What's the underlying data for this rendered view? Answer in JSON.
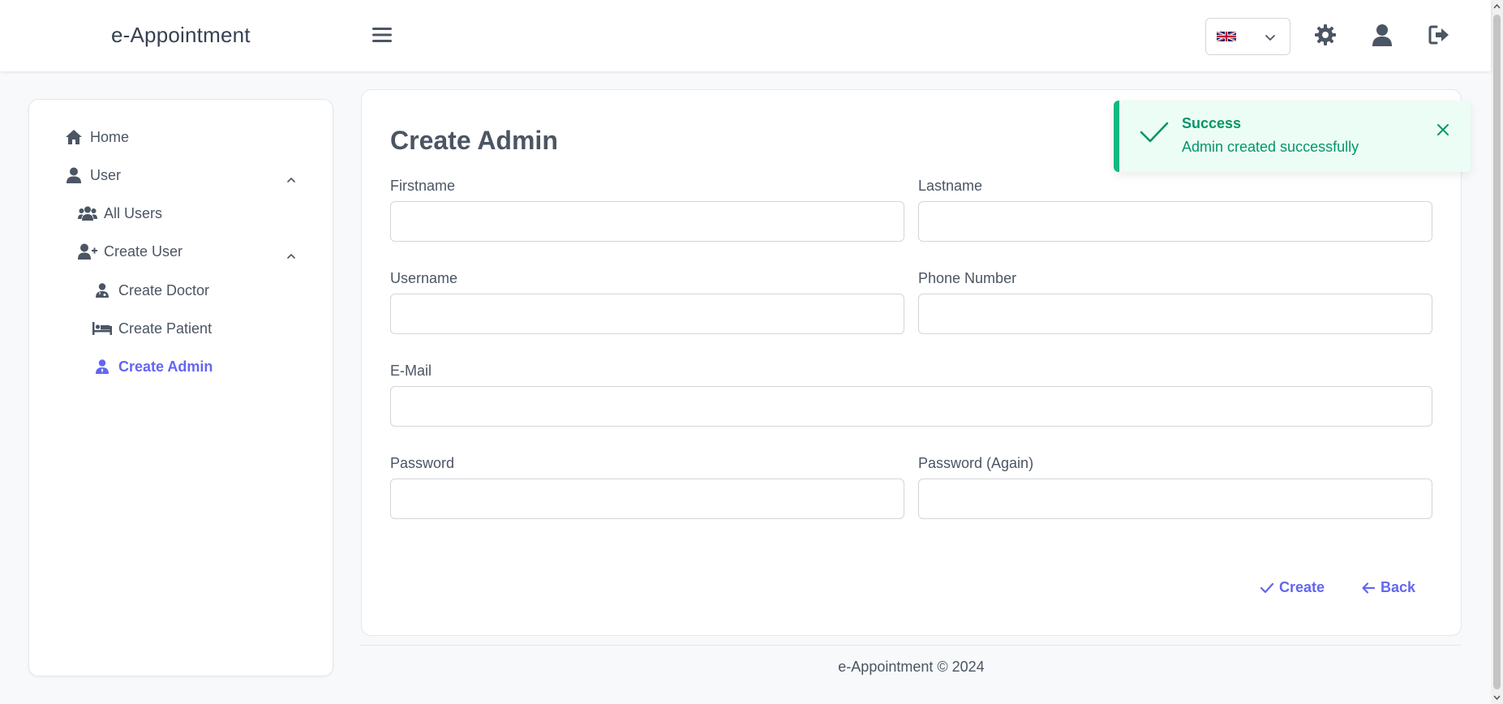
{
  "app": {
    "title": "e-Appointment"
  },
  "header": {
    "language": {
      "selected": "en-GB",
      "flag_icon": "uk-flag-icon"
    },
    "icons": [
      "menu-icon",
      "settings-icon",
      "user-icon",
      "logout-icon"
    ]
  },
  "sidebar": {
    "items": [
      {
        "label": "Home",
        "icon": "home-icon"
      },
      {
        "label": "User",
        "icon": "user-icon",
        "expanded": true
      },
      {
        "label": "All Users",
        "icon": "users-group-icon"
      },
      {
        "label": "Create User",
        "icon": "user-plus-icon",
        "expanded": true
      },
      {
        "label": "Create Doctor",
        "icon": "doctor-icon"
      },
      {
        "label": "Create Patient",
        "icon": "bed-icon"
      },
      {
        "label": "Create Admin",
        "icon": "admin-icon",
        "active": true
      }
    ]
  },
  "form": {
    "title": "Create Admin",
    "fields": {
      "firstname": {
        "label": "Firstname",
        "value": ""
      },
      "lastname": {
        "label": "Lastname",
        "value": ""
      },
      "username": {
        "label": "Username",
        "value": ""
      },
      "phone": {
        "label": "Phone Number",
        "value": ""
      },
      "email": {
        "label": "E-Mail",
        "value": ""
      },
      "password": {
        "label": "Password",
        "value": ""
      },
      "password_again": {
        "label": "Password (Again)",
        "value": ""
      }
    },
    "actions": {
      "create": "Create",
      "back": "Back"
    }
  },
  "toast": {
    "title": "Success",
    "message": "Admin created successfully"
  },
  "footer": {
    "text": "e-Appointment © 2024"
  },
  "colors": {
    "accent": "#6366f1",
    "success": "#10b981",
    "success_bg": "#ecfdf5",
    "text": "#4b5563"
  }
}
